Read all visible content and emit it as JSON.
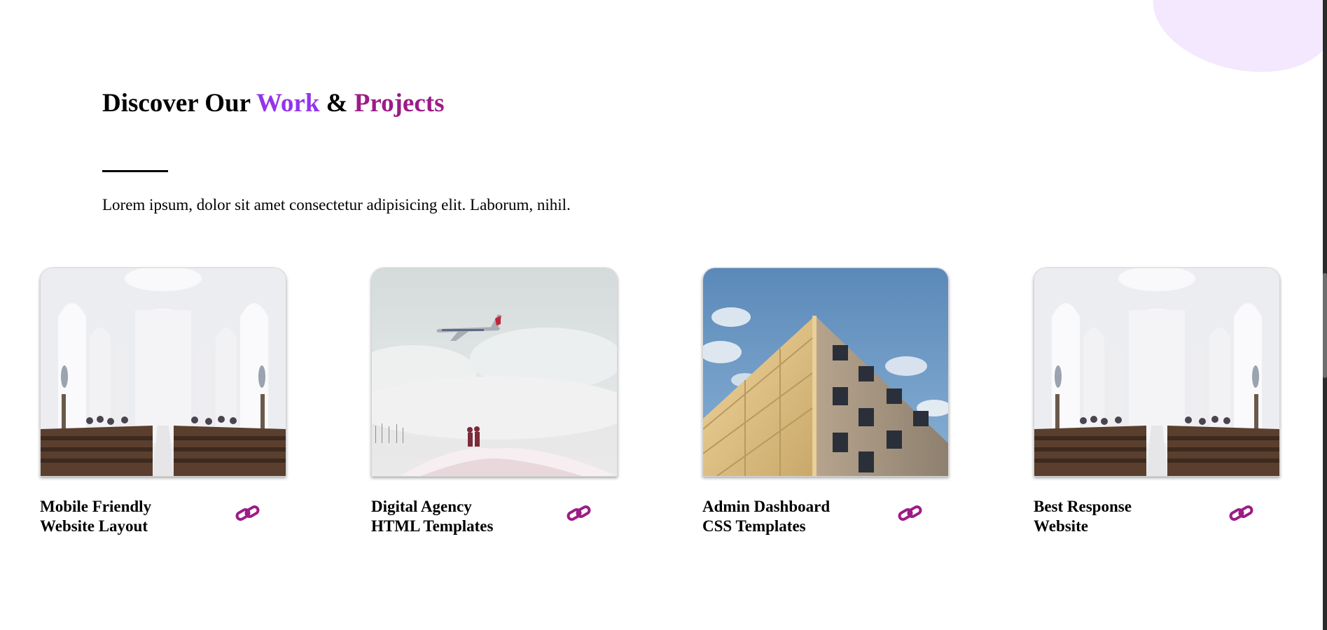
{
  "section": {
    "title": {
      "part1": "Discover Our ",
      "part2": "Work",
      "part3": " & ",
      "part4": "Projects"
    },
    "description": "Lorem ipsum, dolor sit amet consectetur adipisicing elit. Laborum, nihil."
  },
  "colors": {
    "accent_purple": "#9334ea",
    "accent_magenta": "#9c1c86",
    "blob": "#f3e8fd"
  },
  "cards": [
    {
      "image": "church-interior",
      "title_line1": "Mobile Friendly",
      "title_line2": "Website Layout",
      "icon": "link-icon"
    },
    {
      "image": "airplane-over-snow",
      "title_line1": "Digital Agency",
      "title_line2": "HTML Templates",
      "icon": "link-icon"
    },
    {
      "image": "building-corner-sky",
      "title_line1": "Admin Dashboard",
      "title_line2": "CSS Templates",
      "icon": "link-icon"
    },
    {
      "image": "church-interior",
      "title_line1": "Best Response",
      "title_line2": "Website",
      "icon": "link-icon"
    }
  ]
}
